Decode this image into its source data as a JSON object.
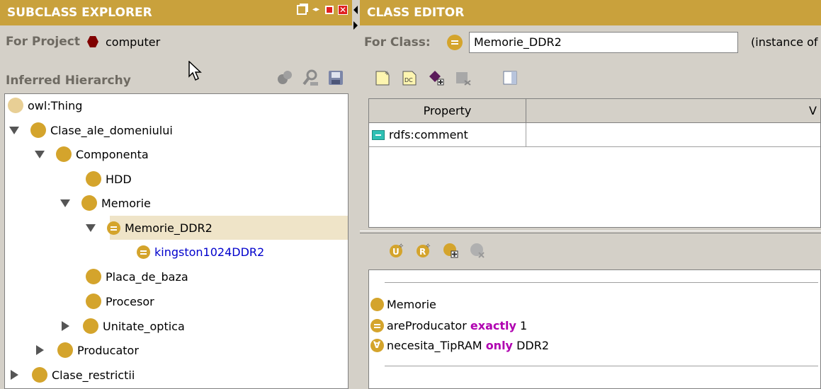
{
  "left_panel": {
    "title": "SUBCLASS EXPLORER",
    "project_label": "For Project",
    "project_name": "computer",
    "hierarchy_label": "Inferred Hierarchy",
    "tree": [
      {
        "label": "owl:Thing"
      },
      {
        "label": "Clase_ale_domeniului"
      },
      {
        "label": "Componenta"
      },
      {
        "label": "HDD"
      },
      {
        "label": "Memorie"
      },
      {
        "label": "Memorie_DDR2"
      },
      {
        "label": "kingston1024DDR2"
      },
      {
        "label": "Placa_de_baza"
      },
      {
        "label": "Procesor"
      },
      {
        "label": "Unitate_optica"
      },
      {
        "label": "Producator"
      },
      {
        "label": "Clase_restrictii"
      }
    ]
  },
  "right_panel": {
    "title": "CLASS EDITOR",
    "class_label": "For Class:",
    "class_value": "Memorie_DDR2",
    "class_extra": "(instance of",
    "table": {
      "headers": [
        "Property",
        "V"
      ],
      "rows": [
        {
          "property": "rdfs:comment",
          "value": ""
        }
      ]
    },
    "conditions": {
      "c1": {
        "name": "Memorie"
      },
      "c2": {
        "prop": "areProducator",
        "kw": "exactly",
        "val": "1"
      },
      "c3": {
        "prop": "necesita_TipRAM",
        "kw": "only",
        "val": "DDR2"
      }
    }
  },
  "colors": {
    "titlebar": "#c9a13c",
    "class_ball": "#d4a42c",
    "keyword": "#b000b0",
    "instance_link": "#0000cc",
    "selection": "#efe4c8"
  }
}
